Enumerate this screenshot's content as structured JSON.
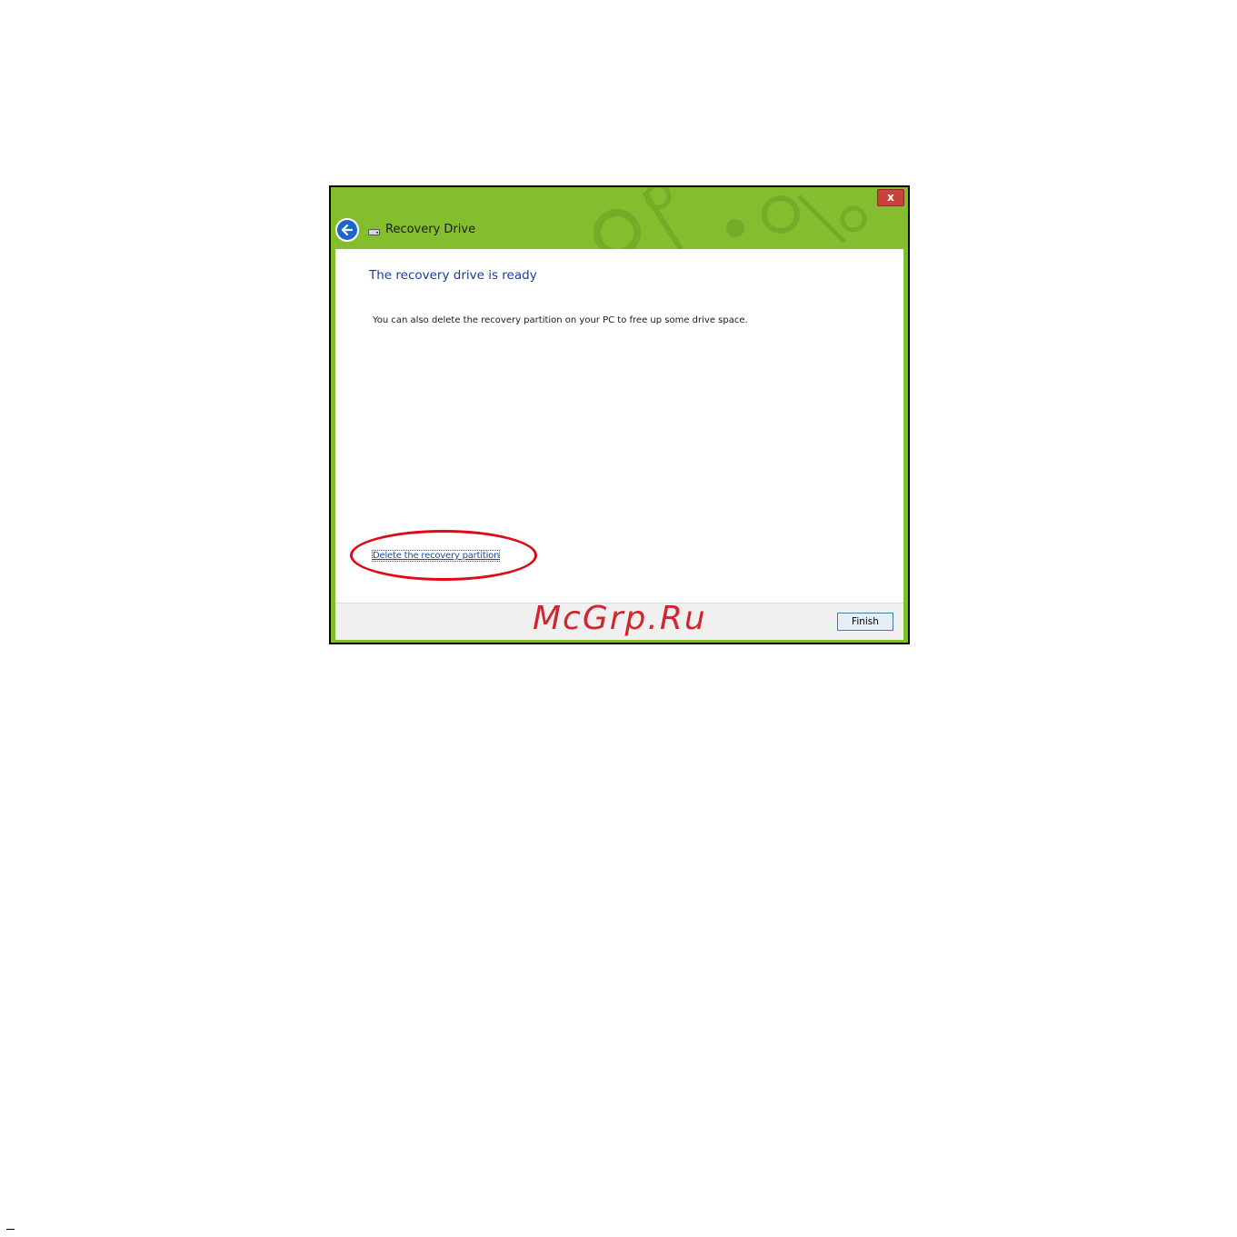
{
  "window": {
    "title": "Recovery Drive",
    "close_label": "x"
  },
  "content": {
    "heading": "The recovery drive is ready",
    "description": "You can also delete the recovery partition on your PC to free up some drive space.",
    "link_label": "Delete the recovery partition"
  },
  "footer": {
    "finish_label": "Finish"
  },
  "watermark": "McGrp.Ru",
  "colors": {
    "titlebar": "#84be2f",
    "heading": "#1e3c9a",
    "link": "#1a4fa8",
    "highlight": "#e00a16",
    "back_button": "#1a66c9"
  },
  "icons": {
    "back": "back-arrow-icon",
    "drive": "drive-icon",
    "close": "close-icon"
  }
}
